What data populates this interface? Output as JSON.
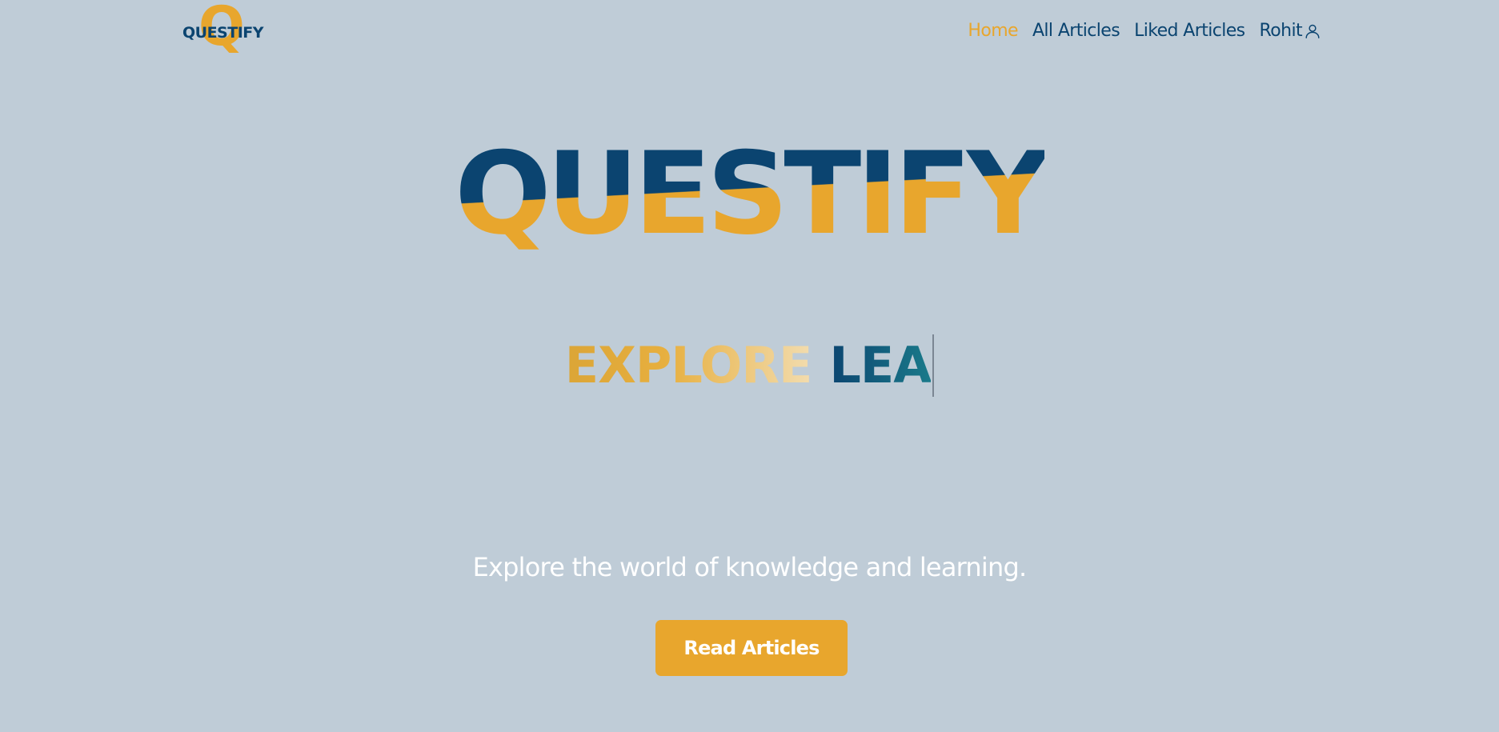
{
  "brand": {
    "logo_letter": "Q",
    "logo_text": "QUESTIFY",
    "colors": {
      "primary": "#0b4470",
      "accent": "#e8a62d",
      "background": "#bfccd7"
    }
  },
  "nav": {
    "items": [
      {
        "label": "Home",
        "active": true
      },
      {
        "label": "All Articles",
        "active": false
      },
      {
        "label": "Liked Articles",
        "active": false
      }
    ],
    "user": {
      "name": "Rohit",
      "icon": "user-icon"
    }
  },
  "hero": {
    "title": "QUESTIFY",
    "typing": {
      "word1": "EXPLORE",
      "word2": "LEA"
    },
    "tagline": "Explore the world of knowledge and learning.",
    "cta_label": "Read Articles"
  }
}
